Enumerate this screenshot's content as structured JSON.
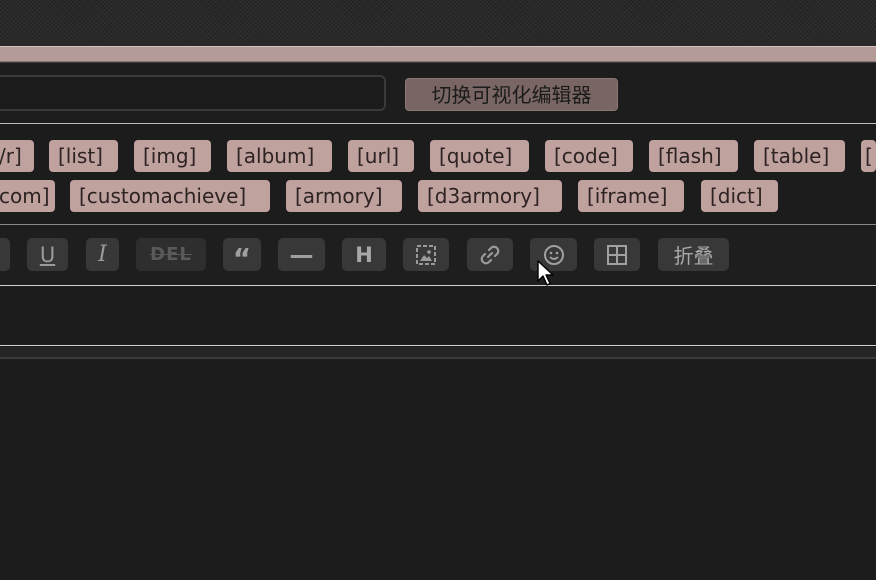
{
  "title_row": {
    "input_value": "",
    "switch_editor_label": "切换可视化编辑器"
  },
  "tags": {
    "row1": [
      "/r]",
      "[list]",
      "[img]",
      "[album]",
      "[url]",
      "[quote]",
      "[code]",
      "[flash]",
      "[table]",
      "["
    ],
    "row2": [
      "com]",
      "[customachieve]",
      "[armory]",
      "[d3armory]",
      "[iframe]",
      "[dict]"
    ]
  },
  "toolbar": {
    "underline_label": "U",
    "italic_label": "I",
    "delete_label": "DEL",
    "quote_label": "“",
    "hr_label": "—",
    "heading_label": "H",
    "fold_label": "折叠",
    "icons": [
      "underline-icon",
      "italic-icon",
      "strikethrough-icon",
      "quote-icon",
      "horizontal-rule-icon",
      "heading-icon",
      "image-icon",
      "link-icon",
      "emoji-icon",
      "table-icon"
    ]
  },
  "colors": {
    "tag_bg": "#bfa19e",
    "accent_bar": "#b49b98",
    "switch_button_bg": "#796664",
    "background": "#1c1c1c"
  }
}
